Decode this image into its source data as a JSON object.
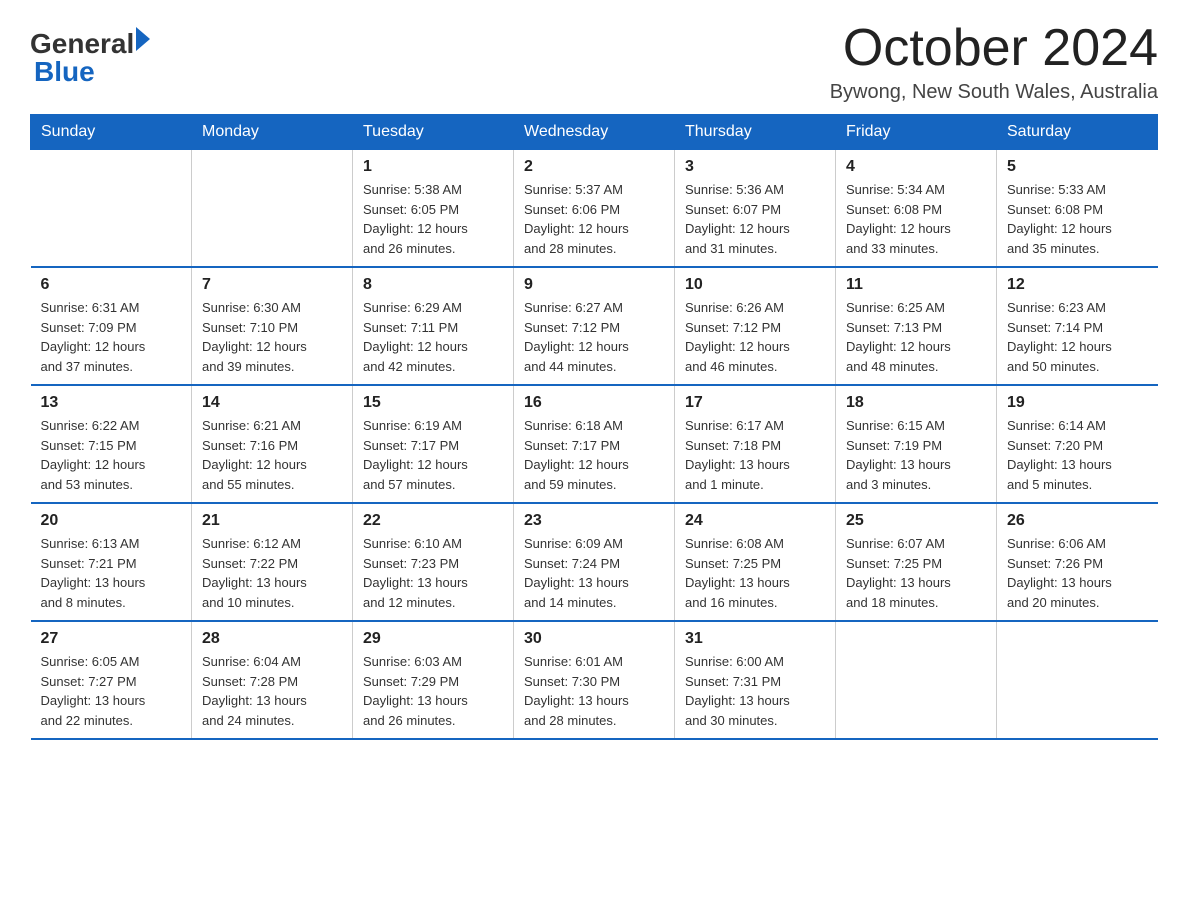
{
  "header": {
    "logo_general": "General",
    "logo_blue": "Blue",
    "month_title": "October 2024",
    "location": "Bywong, New South Wales, Australia"
  },
  "days_of_week": [
    "Sunday",
    "Monday",
    "Tuesday",
    "Wednesday",
    "Thursday",
    "Friday",
    "Saturday"
  ],
  "weeks": [
    [
      {
        "day": "",
        "info": ""
      },
      {
        "day": "",
        "info": ""
      },
      {
        "day": "1",
        "info": "Sunrise: 5:38 AM\nSunset: 6:05 PM\nDaylight: 12 hours\nand 26 minutes."
      },
      {
        "day": "2",
        "info": "Sunrise: 5:37 AM\nSunset: 6:06 PM\nDaylight: 12 hours\nand 28 minutes."
      },
      {
        "day": "3",
        "info": "Sunrise: 5:36 AM\nSunset: 6:07 PM\nDaylight: 12 hours\nand 31 minutes."
      },
      {
        "day": "4",
        "info": "Sunrise: 5:34 AM\nSunset: 6:08 PM\nDaylight: 12 hours\nand 33 minutes."
      },
      {
        "day": "5",
        "info": "Sunrise: 5:33 AM\nSunset: 6:08 PM\nDaylight: 12 hours\nand 35 minutes."
      }
    ],
    [
      {
        "day": "6",
        "info": "Sunrise: 6:31 AM\nSunset: 7:09 PM\nDaylight: 12 hours\nand 37 minutes."
      },
      {
        "day": "7",
        "info": "Sunrise: 6:30 AM\nSunset: 7:10 PM\nDaylight: 12 hours\nand 39 minutes."
      },
      {
        "day": "8",
        "info": "Sunrise: 6:29 AM\nSunset: 7:11 PM\nDaylight: 12 hours\nand 42 minutes."
      },
      {
        "day": "9",
        "info": "Sunrise: 6:27 AM\nSunset: 7:12 PM\nDaylight: 12 hours\nand 44 minutes."
      },
      {
        "day": "10",
        "info": "Sunrise: 6:26 AM\nSunset: 7:12 PM\nDaylight: 12 hours\nand 46 minutes."
      },
      {
        "day": "11",
        "info": "Sunrise: 6:25 AM\nSunset: 7:13 PM\nDaylight: 12 hours\nand 48 minutes."
      },
      {
        "day": "12",
        "info": "Sunrise: 6:23 AM\nSunset: 7:14 PM\nDaylight: 12 hours\nand 50 minutes."
      }
    ],
    [
      {
        "day": "13",
        "info": "Sunrise: 6:22 AM\nSunset: 7:15 PM\nDaylight: 12 hours\nand 53 minutes."
      },
      {
        "day": "14",
        "info": "Sunrise: 6:21 AM\nSunset: 7:16 PM\nDaylight: 12 hours\nand 55 minutes."
      },
      {
        "day": "15",
        "info": "Sunrise: 6:19 AM\nSunset: 7:17 PM\nDaylight: 12 hours\nand 57 minutes."
      },
      {
        "day": "16",
        "info": "Sunrise: 6:18 AM\nSunset: 7:17 PM\nDaylight: 12 hours\nand 59 minutes."
      },
      {
        "day": "17",
        "info": "Sunrise: 6:17 AM\nSunset: 7:18 PM\nDaylight: 13 hours\nand 1 minute."
      },
      {
        "day": "18",
        "info": "Sunrise: 6:15 AM\nSunset: 7:19 PM\nDaylight: 13 hours\nand 3 minutes."
      },
      {
        "day": "19",
        "info": "Sunrise: 6:14 AM\nSunset: 7:20 PM\nDaylight: 13 hours\nand 5 minutes."
      }
    ],
    [
      {
        "day": "20",
        "info": "Sunrise: 6:13 AM\nSunset: 7:21 PM\nDaylight: 13 hours\nand 8 minutes."
      },
      {
        "day": "21",
        "info": "Sunrise: 6:12 AM\nSunset: 7:22 PM\nDaylight: 13 hours\nand 10 minutes."
      },
      {
        "day": "22",
        "info": "Sunrise: 6:10 AM\nSunset: 7:23 PM\nDaylight: 13 hours\nand 12 minutes."
      },
      {
        "day": "23",
        "info": "Sunrise: 6:09 AM\nSunset: 7:24 PM\nDaylight: 13 hours\nand 14 minutes."
      },
      {
        "day": "24",
        "info": "Sunrise: 6:08 AM\nSunset: 7:25 PM\nDaylight: 13 hours\nand 16 minutes."
      },
      {
        "day": "25",
        "info": "Sunrise: 6:07 AM\nSunset: 7:25 PM\nDaylight: 13 hours\nand 18 minutes."
      },
      {
        "day": "26",
        "info": "Sunrise: 6:06 AM\nSunset: 7:26 PM\nDaylight: 13 hours\nand 20 minutes."
      }
    ],
    [
      {
        "day": "27",
        "info": "Sunrise: 6:05 AM\nSunset: 7:27 PM\nDaylight: 13 hours\nand 22 minutes."
      },
      {
        "day": "28",
        "info": "Sunrise: 6:04 AM\nSunset: 7:28 PM\nDaylight: 13 hours\nand 24 minutes."
      },
      {
        "day": "29",
        "info": "Sunrise: 6:03 AM\nSunset: 7:29 PM\nDaylight: 13 hours\nand 26 minutes."
      },
      {
        "day": "30",
        "info": "Sunrise: 6:01 AM\nSunset: 7:30 PM\nDaylight: 13 hours\nand 28 minutes."
      },
      {
        "day": "31",
        "info": "Sunrise: 6:00 AM\nSunset: 7:31 PM\nDaylight: 13 hours\nand 30 minutes."
      },
      {
        "day": "",
        "info": ""
      },
      {
        "day": "",
        "info": ""
      }
    ]
  ]
}
